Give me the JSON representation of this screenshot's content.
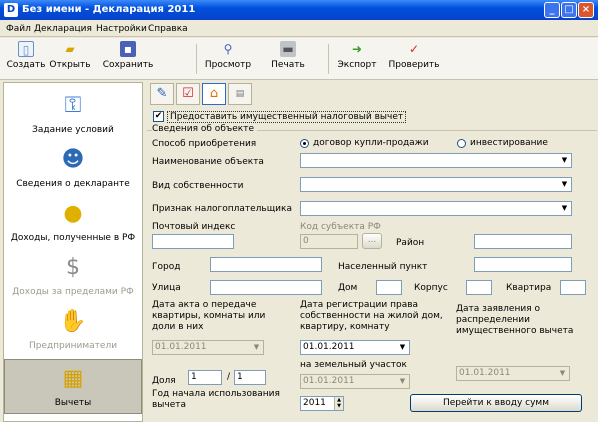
{
  "window": {
    "title": "Без имени - Декларация 2011",
    "icon_letter": "D"
  },
  "menu": [
    "Файл",
    "Декларация",
    "Настройки",
    "Справка"
  ],
  "toolbar": [
    "Создать",
    "Открыть",
    "Сохранить",
    "Просмотр",
    "Печать",
    "Экспорт",
    "Проверить"
  ],
  "sidebar": [
    "Задание условий",
    "Сведения о декларанте",
    "Доходы, полученные в РФ",
    "Доходы за пределами РФ",
    "Предприниматели",
    "Вычеты"
  ],
  "form": {
    "grant_deduction_label": "Предоставить имущественный налоговый вычет",
    "grant_deduction_checked": true,
    "group_title": "Сведения об объекте",
    "acquisition_label": "Способ приобретения",
    "radio_purchase": "договор купли-продажи",
    "radio_investment": "инвестирование",
    "object_name_label": "Наименование объекта",
    "ownership_label": "Вид собственности",
    "taxpayer_sign_label": "Признак налогоплательщика",
    "postal_code_label": "Почтовый индекс",
    "region_code_label": "Код субъекта РФ",
    "region_code_value": "0",
    "browse_label": "...",
    "district_label": "Район",
    "city_label": "Город",
    "locality_label": "Населенный пункт",
    "street_label": "Улица",
    "house_label": "Дом",
    "building_label": "Корпус",
    "apartment_label": "Квартира",
    "transfer_act_label": "Дата акта о передаче квартиры, комнаты или доли в них",
    "transfer_act_value": "01.01.2011",
    "registration_label": "Дата регистрации права собственности на жилой дом, квартиру, комнату",
    "registration_value": "01.01.2011",
    "land_label": "на земельный участок",
    "land_value": "01.01.2011",
    "application_label": "Дата заявления о распределении имущественного вычета",
    "application_value": "01.01.2011",
    "share_label": "Доля",
    "share_num": "1",
    "share_sep": "/",
    "share_den": "1",
    "start_year_label": "Год начала использования вычета",
    "start_year_value": "2011",
    "go_amounts_button": "Перейти к вводу сумм"
  }
}
